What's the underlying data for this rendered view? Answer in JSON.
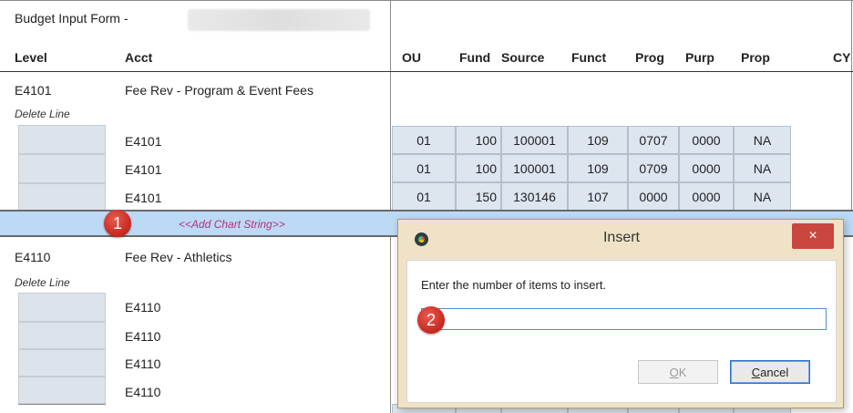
{
  "form": {
    "title": "Budget Input Form -",
    "headers": {
      "level": "Level",
      "acct": "Acct",
      "ou": "OU",
      "fund": "Fund",
      "source": "Source",
      "funct": "Funct",
      "prog": "Prog",
      "purp": "Purp",
      "prop": "Prop",
      "cy": "CY"
    },
    "groups": [
      {
        "level": "E4101",
        "name": "Fee Rev - Program & Event Fees",
        "delete": "Delete Line",
        "rows": [
          {
            "acct": "E4101",
            "ou": "01",
            "fund": "100",
            "source": "100001",
            "funct": "109",
            "prog": "0707",
            "purp": "0000",
            "prop": "NA"
          },
          {
            "acct": "E4101",
            "ou": "01",
            "fund": "100",
            "source": "100001",
            "funct": "109",
            "prog": "0709",
            "purp": "0000",
            "prop": "NA"
          },
          {
            "acct": "E4101",
            "ou": "01",
            "fund": "150",
            "source": "130146",
            "funct": "107",
            "prog": "0000",
            "purp": "0000",
            "prop": "NA"
          }
        ]
      },
      {
        "level": "E4110",
        "name": "Fee Rev - Athletics",
        "delete": "Delete Line",
        "rows": [
          {
            "acct": "E4110"
          },
          {
            "acct": "E4110"
          },
          {
            "acct": "E4110"
          },
          {
            "acct": "E4110"
          }
        ]
      }
    ],
    "add_chart_string": "<<Add Chart String>>"
  },
  "badges": {
    "one": "1",
    "two": "2"
  },
  "dialog": {
    "title": "Insert",
    "close": "×",
    "message": "Enter the number of items to insert.",
    "input_value": "",
    "ok_label": "OK",
    "ok_rest": "K",
    "ok_accel": "O",
    "cancel_accel": "C",
    "cancel_rest": "ancel",
    "cancel_label": "Cancel"
  },
  "icons": [
    "app-logo-icon",
    "close-icon"
  ],
  "colors": {
    "highlight_row": "#bcd9f5",
    "dialog_frame": "#efe2c7",
    "close_button": "#c9473e",
    "badge": "#c4271d",
    "add_link": "#b0337a"
  }
}
